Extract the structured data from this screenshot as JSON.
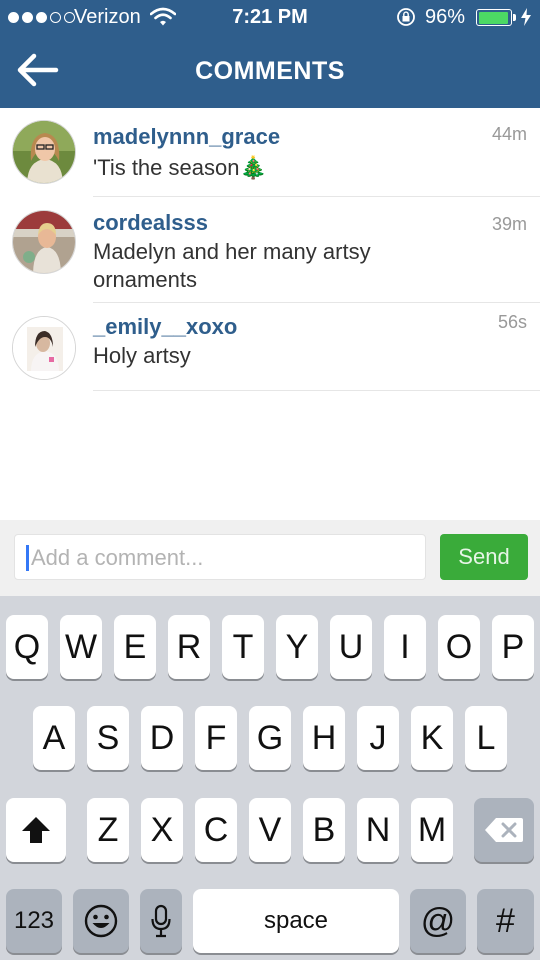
{
  "status_bar": {
    "carrier": "Verizon",
    "time": "7:21 PM",
    "battery_percent": "96%",
    "battery_level": 0.96
  },
  "header": {
    "title": "COMMENTS",
    "back_icon": "back-arrow-icon"
  },
  "comments": [
    {
      "username": "madelynnn_grace",
      "text": "'Tis the season🎄",
      "time": "44m"
    },
    {
      "username": "cordealsss",
      "text": "Madelyn and her many artsy ornaments",
      "time": "39m"
    },
    {
      "username": "_emily__xoxo",
      "text": "Holy artsy",
      "time": "56s"
    }
  ],
  "comment_input": {
    "placeholder": "Add a comment...",
    "value": "",
    "send_label": "Send"
  },
  "keyboard": {
    "row1": [
      "Q",
      "W",
      "E",
      "R",
      "T",
      "Y",
      "U",
      "I",
      "O",
      "P"
    ],
    "row2": [
      "A",
      "S",
      "D",
      "F",
      "G",
      "H",
      "J",
      "K",
      "L"
    ],
    "row3": [
      "Z",
      "X",
      "C",
      "V",
      "B",
      "N",
      "M"
    ],
    "numbers_label": "123",
    "space_label": "space",
    "at_label": "@",
    "hash_label": "#",
    "shift_icon": "shift-arrow-icon",
    "delete_icon": "backspace-icon",
    "emoji_icon": "emoji-icon",
    "mic_icon": "microphone-icon"
  },
  "colors": {
    "header": "#2f5e8c",
    "username": "#2f5e8c",
    "send_button": "#3aab3a",
    "battery": "#4cd964"
  }
}
